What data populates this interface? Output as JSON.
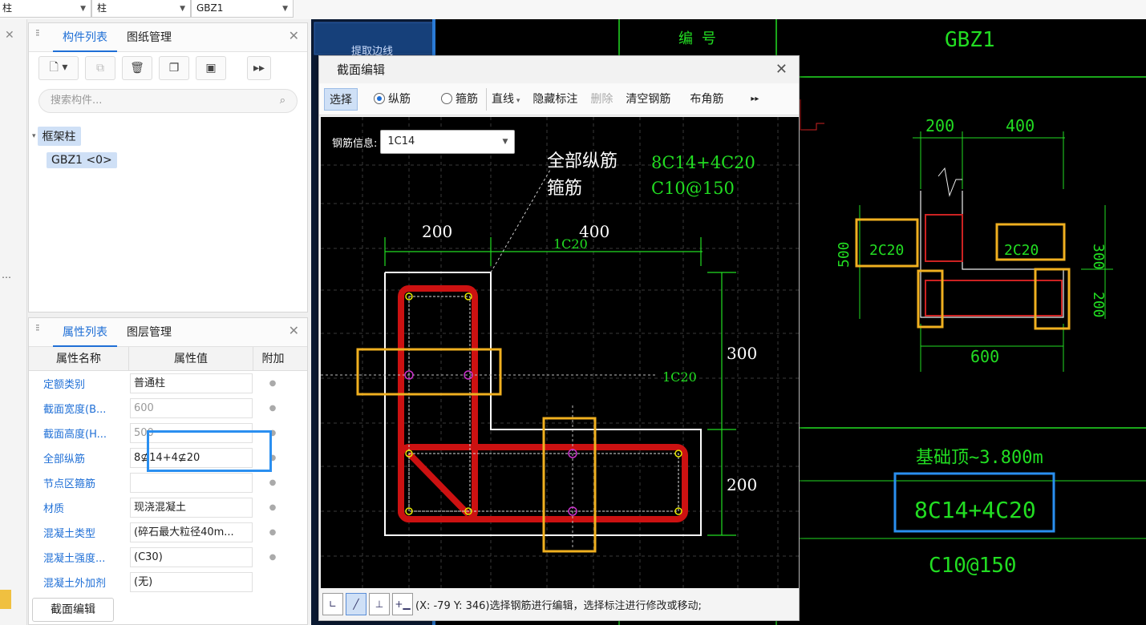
{
  "topbar": {
    "sel1": "柱",
    "sel2": "柱",
    "sel3": "GBZ1"
  },
  "component_panel": {
    "tab_components": "构件列表",
    "tab_drawings": "图纸管理",
    "search_placeholder": "搜索构件...",
    "tree_root": "框架柱",
    "tree_child": "GBZ1 <0>"
  },
  "property_panel": {
    "tab_properties": "属性列表",
    "tab_layers": "图层管理",
    "col_name": "属性名称",
    "col_value": "属性值",
    "col_extra": "附加",
    "rows": [
      {
        "name": "定额类别",
        "value": "普通柱"
      },
      {
        "name": "截面宽度(B...",
        "value": "600"
      },
      {
        "name": "截面高度(H...",
        "value": "500"
      },
      {
        "name": "全部纵筋",
        "value": "8⊈14+4⊈20"
      },
      {
        "name": "节点区箍筋",
        "value": ""
      },
      {
        "name": "材质",
        "value": "现浇混凝土"
      },
      {
        "name": "混凝土类型",
        "value": "(碎石最大粒径40m..."
      },
      {
        "name": "混凝土强度...",
        "value": "(C30)"
      },
      {
        "name": "混凝土外加剂",
        "value": "(无)"
      }
    ],
    "section_edit_button": "截面编辑"
  },
  "dialog": {
    "title": "截面编辑",
    "tools": {
      "select": "选择",
      "longitudinal": "纵筋",
      "stirrup": "箍筋",
      "line": "直线",
      "hide_labels": "隐藏标注",
      "delete": "删除",
      "clear_rebar": "清空钢筋",
      "corner_rebar": "布角筋"
    },
    "rebar_info_label": "钢筋信息:",
    "rebar_info_value": "1C14",
    "canvas": {
      "all_long_label": "全部纵筋",
      "all_long_value": "8C14+4C20",
      "stirrup_label": "箍筋",
      "stirrup_value": "C10@150",
      "dim_200_top": "200",
      "dim_400_top": "400",
      "dim_300_right": "300",
      "dim_200_right": "200",
      "rebar_top": "1C20",
      "rebar_mid": "1C20"
    },
    "status": "(X: -79 Y: 346)选择钢筋进行编辑，选择标注进行修改或移动;"
  },
  "cad": {
    "header_number": "编 号",
    "header_name": "GBZ1",
    "left_top_label": "提取边线",
    "dim_200": "200",
    "dim_400": "400",
    "dim_500": "500",
    "dim_300": "300",
    "dim_200b": "200",
    "dim_600": "600",
    "left_rebar": "2C20",
    "right_rebar": "2C20",
    "elevation": "基础顶~3.800m",
    "long_rebar": "8C14+4C20",
    "stirrup": "C10@150"
  },
  "colors": {
    "accent": "#1f6fd6",
    "highlight_orange": "#f0b020",
    "highlight_blue": "#2a8ff0",
    "cad_green": "#22dd22",
    "rebar_red": "#cc1111"
  }
}
